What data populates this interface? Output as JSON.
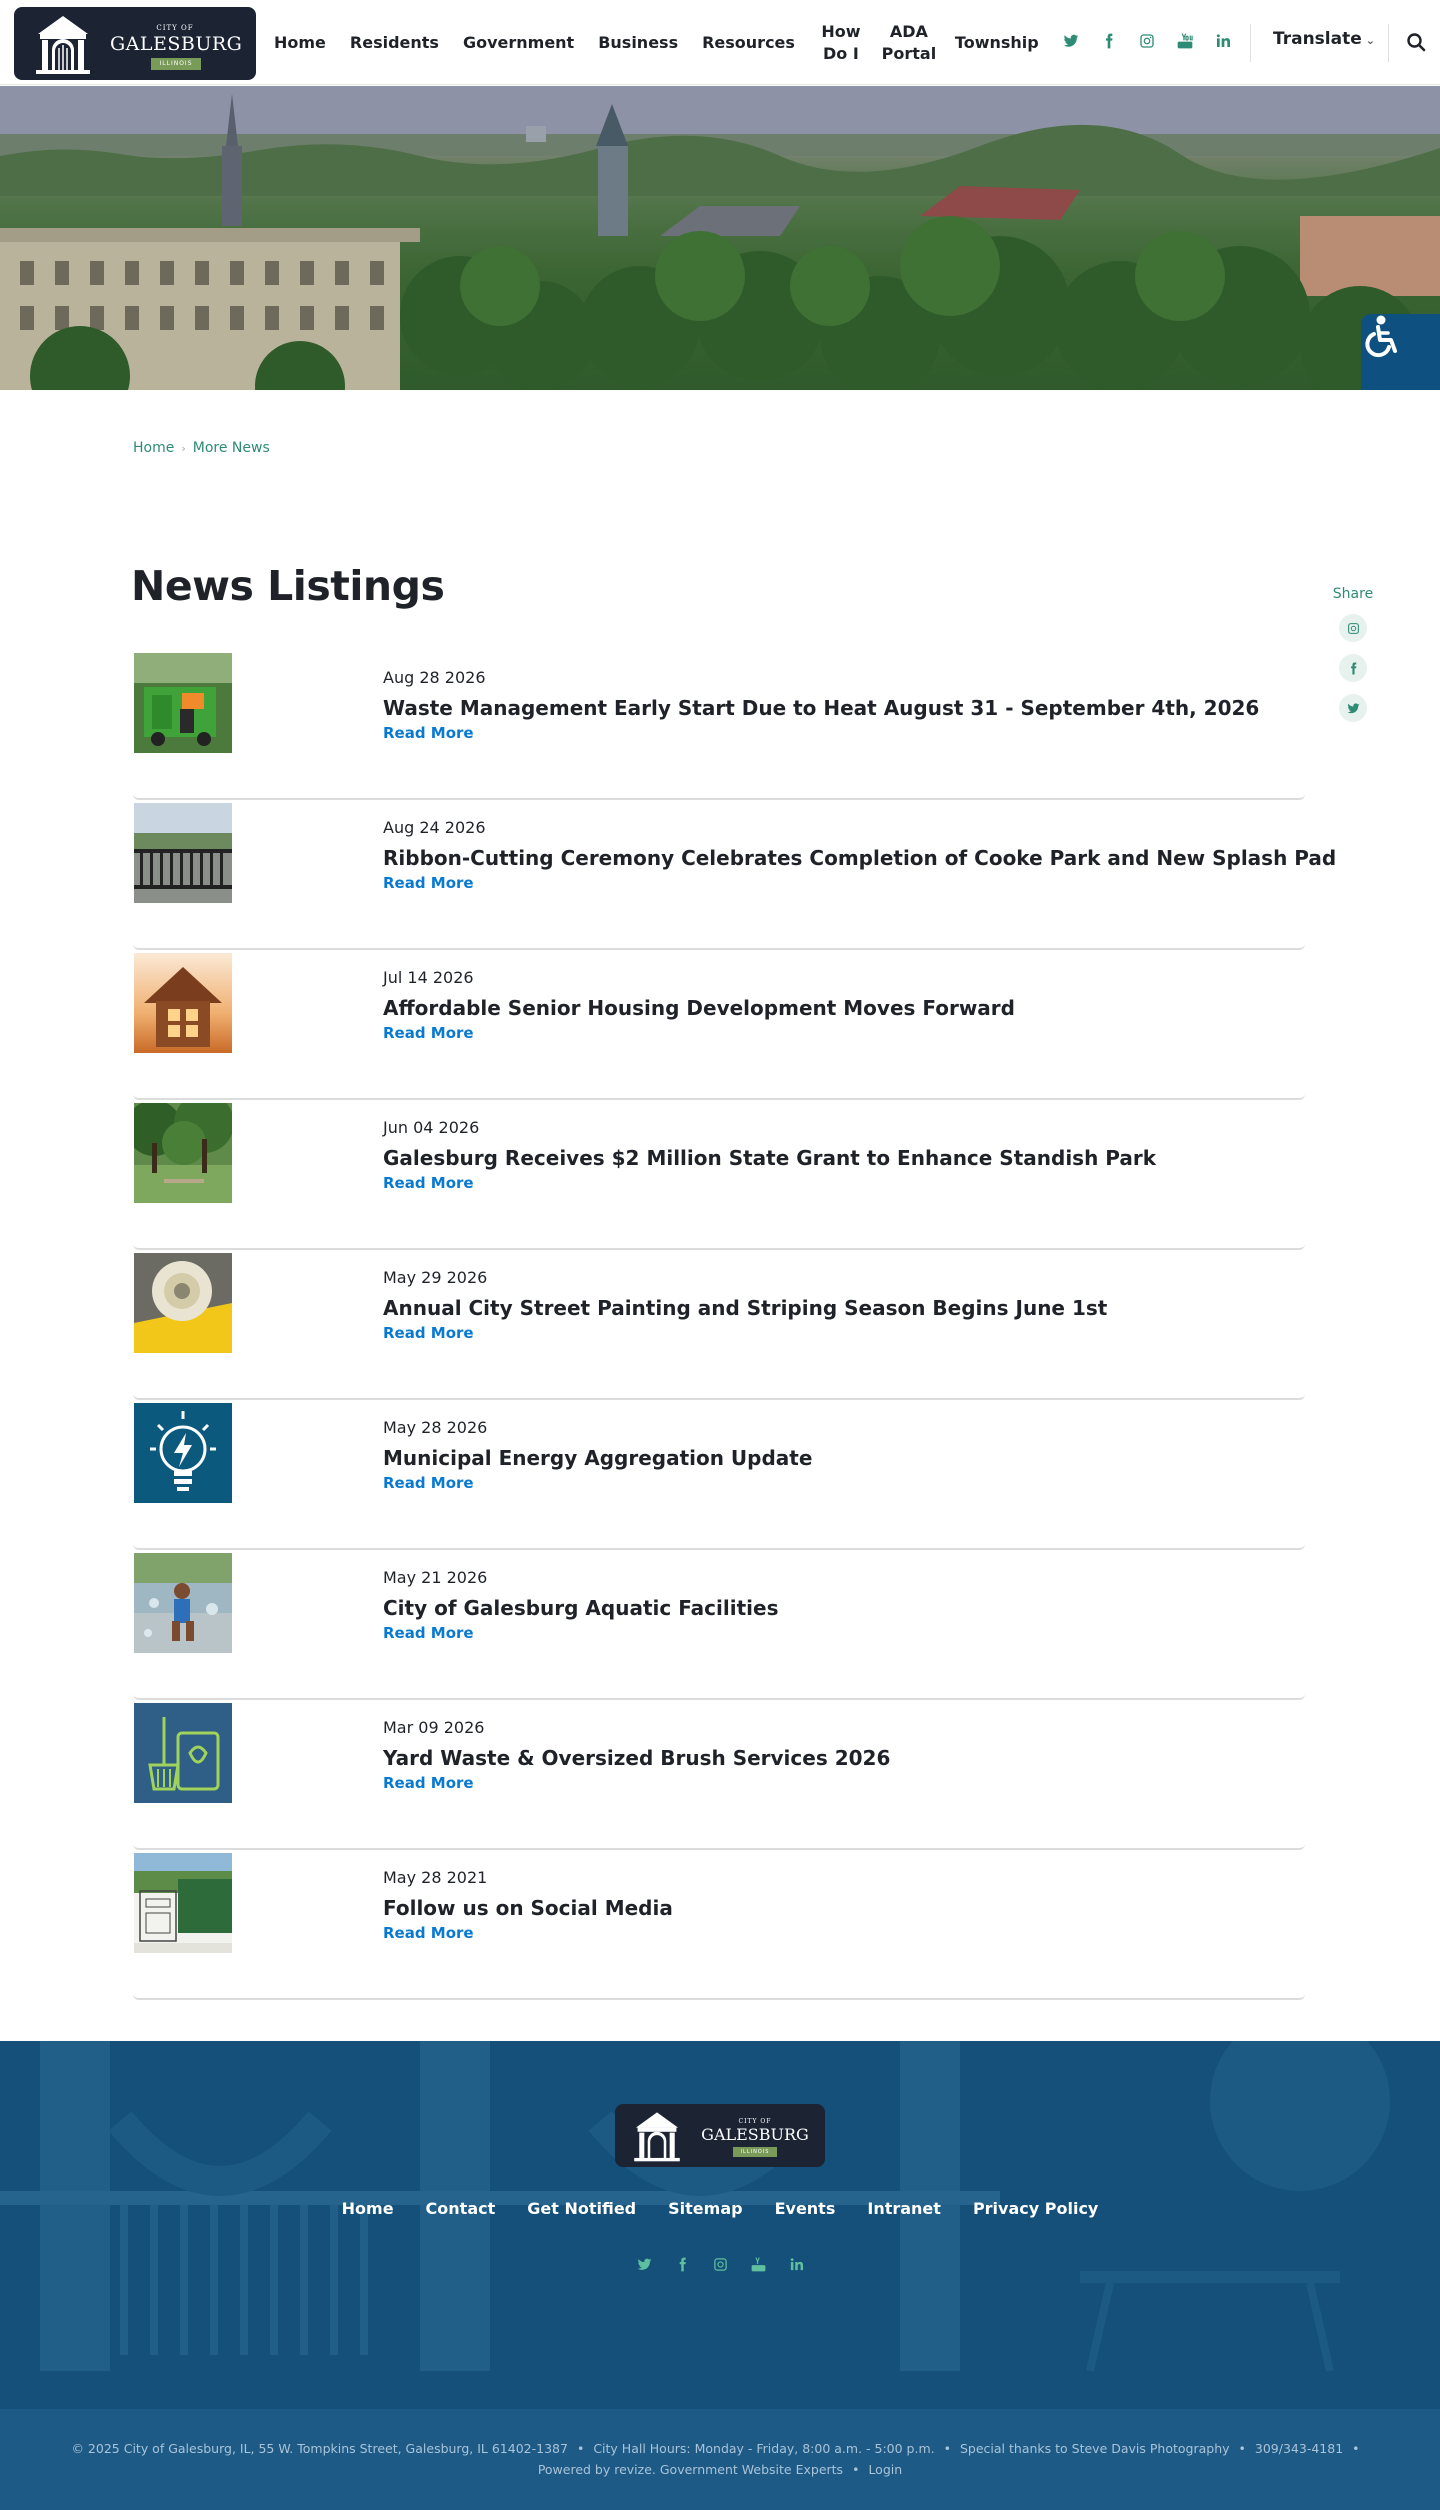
{
  "header": {
    "logo": {
      "city_of": "CITY OF",
      "name": "GALESBURG",
      "state": "ILLINOIS"
    },
    "nav": [
      {
        "label": "Home"
      },
      {
        "label": "Residents"
      },
      {
        "label": "Government"
      },
      {
        "label": "Business"
      },
      {
        "label": "Resources"
      },
      {
        "label": "How Do I"
      },
      {
        "label": "ADA Portal"
      },
      {
        "label": "Township"
      }
    ],
    "social": [
      "twitter-icon",
      "facebook-icon",
      "instagram-icon",
      "youtube-icon",
      "linkedin-icon"
    ],
    "translate_label": "Translate",
    "accent": "#2e8b74"
  },
  "breadcrumb": {
    "home": "Home",
    "current": "More News"
  },
  "page_title": "News Listings",
  "share": {
    "label": "Share",
    "buttons": [
      "instagram-icon",
      "facebook-icon",
      "twitter-icon"
    ]
  },
  "news": [
    {
      "date": "Aug 28 2026",
      "title": "Waste Management Early Start Due to Heat August 31 - September 4th, 2026",
      "link": "Read More",
      "thumb": "garbage-truck"
    },
    {
      "date": "Aug 24 2026",
      "title": "Ribbon-Cutting Ceremony Celebrates Completion of Cooke Park and New Splash Pad",
      "link": "Read More",
      "thumb": "park-fence"
    },
    {
      "date": "Jul 14 2026",
      "title": "Affordable Senior Housing Development Moves Forward",
      "link": "Read More",
      "thumb": "house-sunset"
    },
    {
      "date": "Jun 04 2026",
      "title": "Galesburg Receives $2 Million State Grant to Enhance Standish Park",
      "link": "Read More",
      "thumb": "park-trees"
    },
    {
      "date": "May 29 2026",
      "title": "Annual City Street Painting and Striping Season Begins June 1st",
      "link": "Read More",
      "thumb": "paint-roller"
    },
    {
      "date": "May 28 2026",
      "title": "Municipal Energy Aggregation Update",
      "link": "Read More",
      "thumb": "lightbulb"
    },
    {
      "date": "May 21 2026",
      "title": "City of Galesburg Aquatic Facilities",
      "link": "Read More",
      "thumb": "splash-pad"
    },
    {
      "date": "Mar 09 2026",
      "title": "Yard Waste & Oversized Brush Services 2026",
      "link": "Read More",
      "thumb": "yard-waste"
    },
    {
      "date": "May 28 2021",
      "title": "Follow us on Social Media",
      "link": "Read More",
      "thumb": "social-graphic"
    }
  ],
  "footer": {
    "logo": {
      "city_of": "CITY OF",
      "name": "GALESBURG",
      "state": "ILLINOIS"
    },
    "links": [
      "Home",
      "Contact",
      "Get Notified",
      "Sitemap",
      "Events",
      "Intranet",
      "Privacy Policy"
    ],
    "social": [
      "twitter-icon",
      "facebook-icon",
      "instagram-icon",
      "youtube-icon",
      "linkedin-icon"
    ],
    "copyright": "© 2025 City of Galesburg, IL, 55 W. Tompkins Street, Galesburg, IL 61402-1387",
    "hours": "City Hall Hours: Monday - Friday, 8:00 a.m. - 5:00 p.m.",
    "thanks": "Special thanks to Steve Davis Photography",
    "phone": "309/343-4181",
    "powered": "Powered by revize. Government Website Experts",
    "login": "Login"
  }
}
